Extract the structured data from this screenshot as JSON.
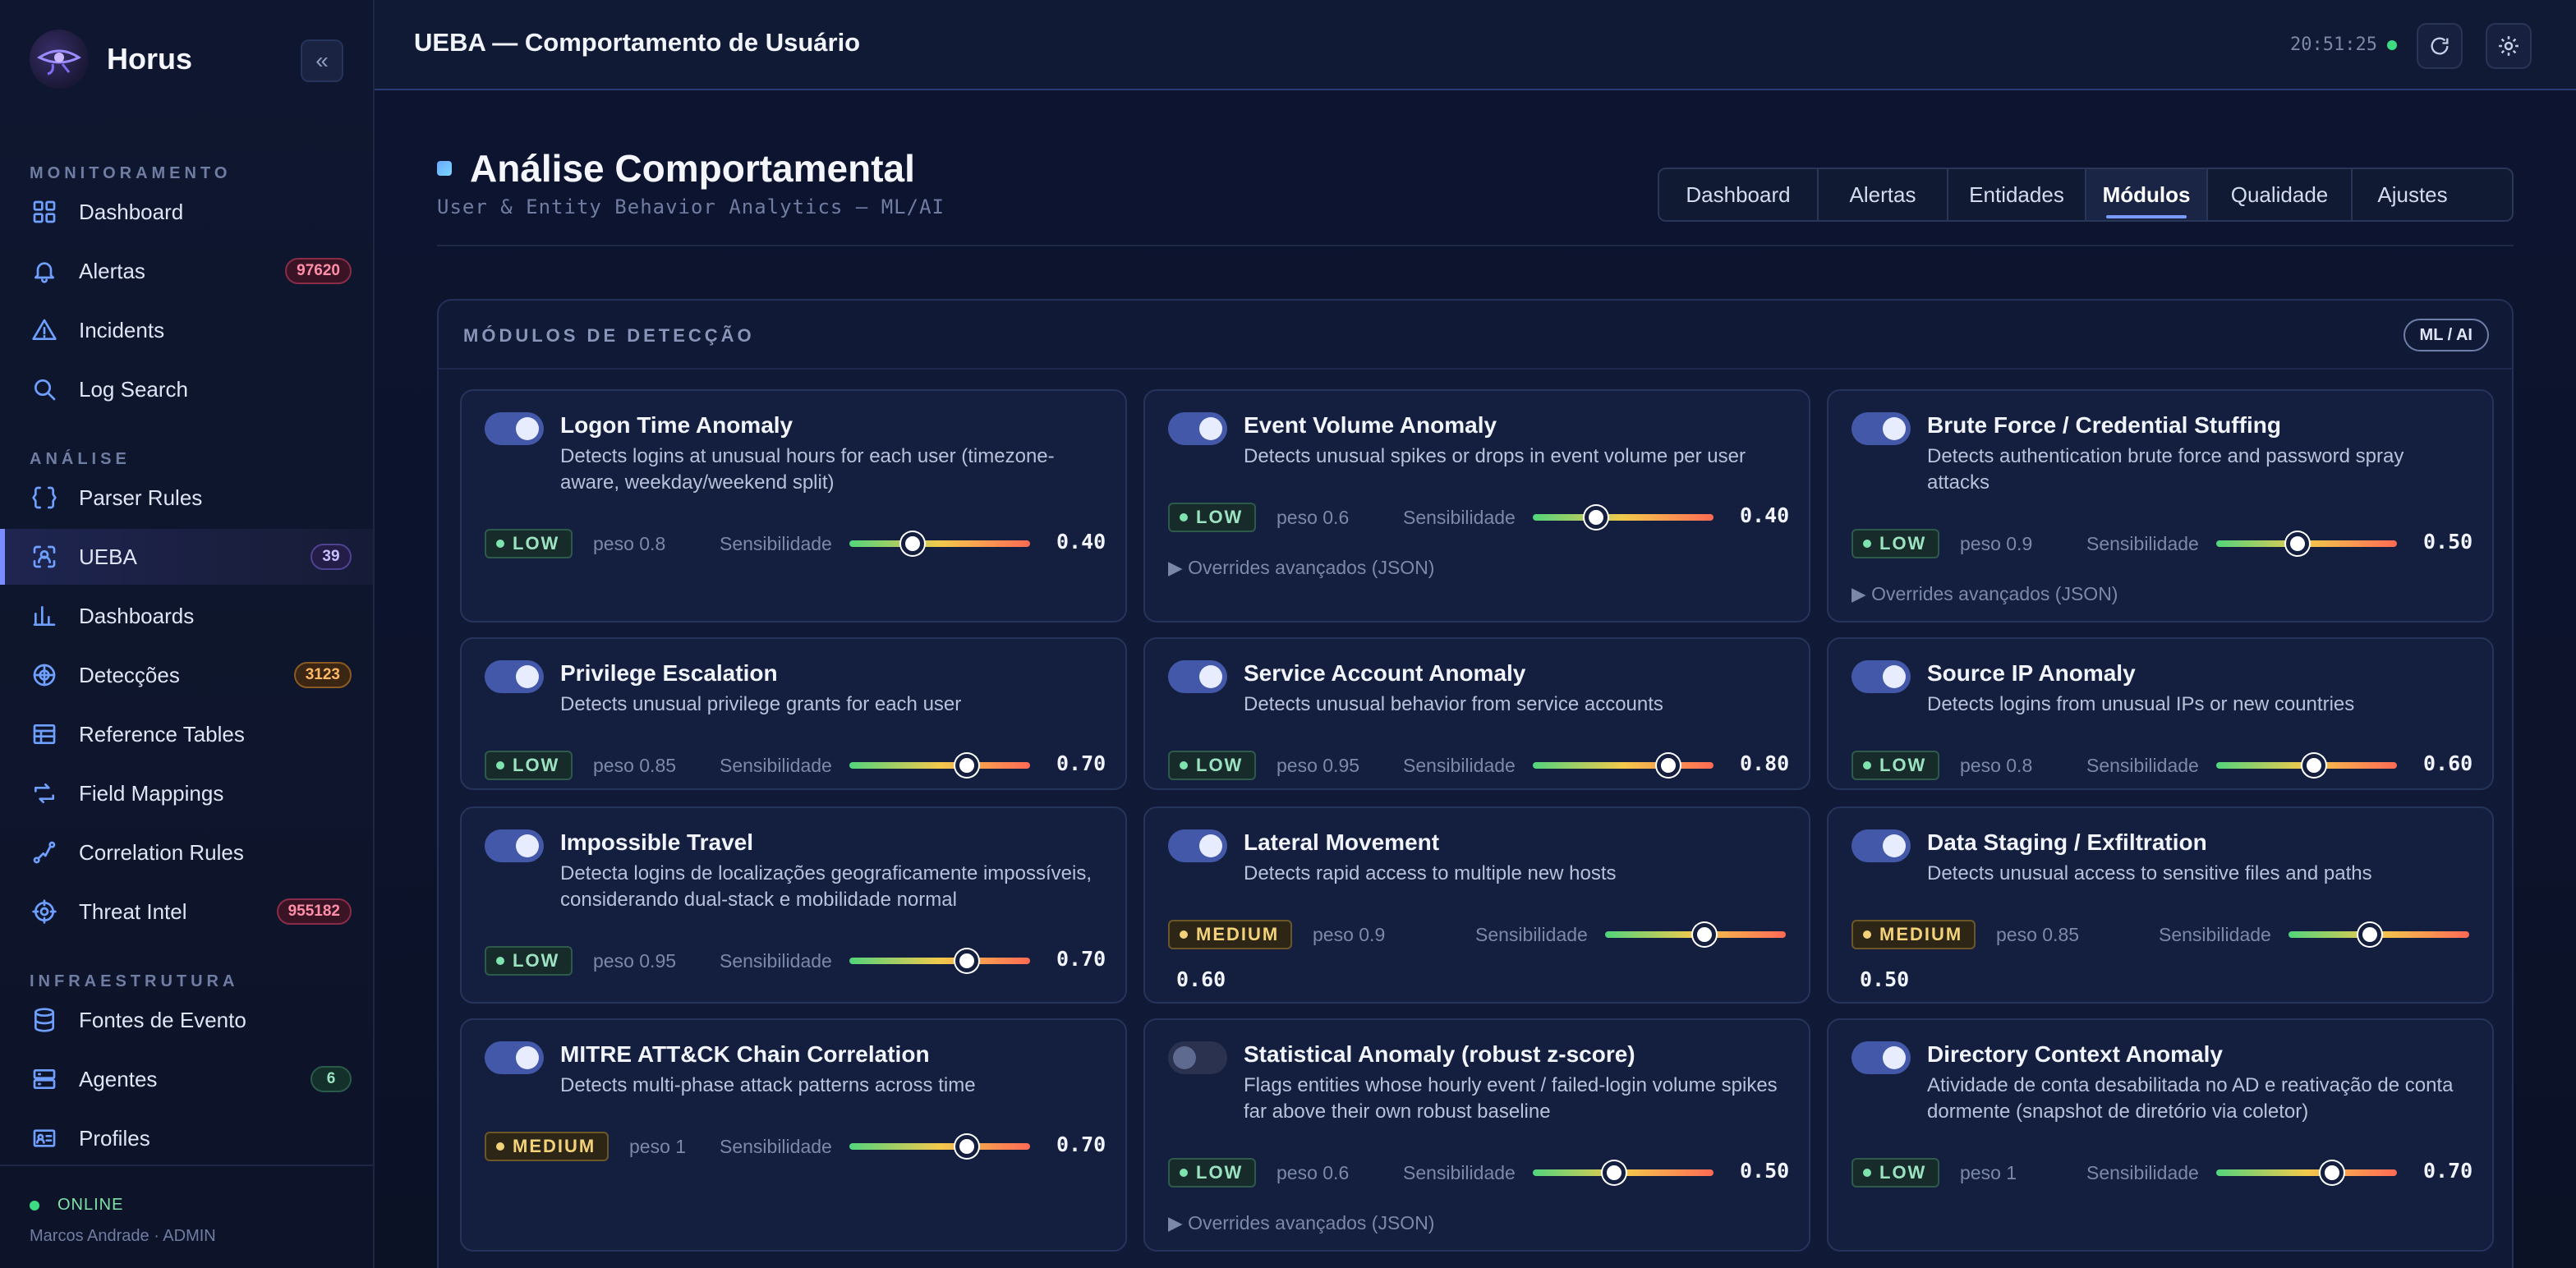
{
  "brand": {
    "name": "Horus"
  },
  "sidebar": {
    "sections": [
      {
        "title": "MONITORAMENTO",
        "items": [
          {
            "label": "Dashboard",
            "icon": "grid-icon"
          },
          {
            "label": "Alertas",
            "icon": "bell-icon",
            "badge": "97620",
            "badge_color": "red"
          },
          {
            "label": "Incidents",
            "icon": "warning-icon"
          },
          {
            "label": "Log Search",
            "icon": "search-icon"
          }
        ]
      },
      {
        "title": "ANÁLISE",
        "items": [
          {
            "label": "Parser Rules",
            "icon": "braces-icon"
          },
          {
            "label": "UEBA",
            "icon": "user-scan-icon",
            "badge": "39",
            "badge_color": "purple",
            "active": true
          },
          {
            "label": "Dashboards",
            "icon": "bar-chart-icon"
          },
          {
            "label": "Detecções",
            "icon": "radar-icon",
            "badge": "3123",
            "badge_color": "orange"
          },
          {
            "label": "Reference Tables",
            "icon": "table-icon"
          },
          {
            "label": "Field Mappings",
            "icon": "mapping-icon"
          },
          {
            "label": "Correlation Rules",
            "icon": "correlation-icon"
          },
          {
            "label": "Threat Intel",
            "icon": "threat-intel-icon",
            "badge": "955182",
            "badge_color": "red"
          }
        ]
      },
      {
        "title": "INFRAESTRUTURA",
        "items": [
          {
            "label": "Fontes de Evento",
            "icon": "database-icon"
          },
          {
            "label": "Agentes",
            "icon": "server-icon",
            "badge": "6",
            "badge_color": "green"
          },
          {
            "label": "Profiles",
            "icon": "id-card-icon"
          }
        ]
      }
    ],
    "status": "ONLINE",
    "user": "Marcos Andrade · ADMIN"
  },
  "topbar": {
    "title": "UEBA — Comportamento de Usuário",
    "clock": "20:51:25"
  },
  "page": {
    "title": "Análise Comportamental",
    "subtitle": "User & Entity Behavior Analytics — ML/AI",
    "tabs": [
      {
        "label": "Dashboard"
      },
      {
        "label": "Alertas"
      },
      {
        "label": "Entidades"
      },
      {
        "label": "Módulos",
        "active": true
      },
      {
        "label": "Qualidade"
      },
      {
        "label": "Ajustes"
      }
    ]
  },
  "panel": {
    "title": "MÓDULOS DE DETECÇÃO",
    "pill": "ML / AI",
    "sens_label": "Sensibilidade",
    "overrides_label": "▶ Overrides avançados (JSON)",
    "modules": [
      {
        "title": "Logon Time Anomaly",
        "desc": "Detects logins at unusual hours for each user (timezone-aware, weekday/weekend split)",
        "level": "LOW",
        "peso": "peso 0.8",
        "sens": 0.4,
        "sens_text": "0.40",
        "enabled": true,
        "overrides": false
      },
      {
        "title": "Event Volume Anomaly",
        "desc": "Detects unusual spikes or drops in event volume per user",
        "level": "LOW",
        "peso": "peso 0.6",
        "sens": 0.4,
        "sens_text": "0.40",
        "enabled": true,
        "overrides": true
      },
      {
        "title": "Brute Force / Credential Stuffing",
        "desc": "Detects authentication brute force and password spray attacks",
        "level": "LOW",
        "peso": "peso 0.9",
        "sens": 0.5,
        "sens_text": "0.50",
        "enabled": true,
        "overrides": true
      },
      {
        "title": "Privilege Escalation",
        "desc": "Detects unusual privilege grants for each user",
        "level": "LOW",
        "peso": "peso 0.85",
        "sens": 0.7,
        "sens_text": "0.70",
        "enabled": true,
        "overrides": false
      },
      {
        "title": "Service Account Anomaly",
        "desc": "Detects unusual behavior from service accounts",
        "level": "LOW",
        "peso": "peso 0.95",
        "sens": 0.8,
        "sens_text": "0.80",
        "enabled": true,
        "overrides": false
      },
      {
        "title": "Source IP Anomaly",
        "desc": "Detects logins from unusual IPs or new countries",
        "level": "LOW",
        "peso": "peso 0.8",
        "sens": 0.6,
        "sens_text": "0.60",
        "enabled": true,
        "overrides": false
      },
      {
        "title": "Impossible Travel",
        "desc": "Detecta logins de localizações geograficamente impossíveis, considerando dual-stack e mobilidade normal",
        "level": "LOW",
        "peso": "peso 0.95",
        "sens": 0.7,
        "sens_text": "0.70",
        "enabled": true,
        "overrides": false
      },
      {
        "title": "Lateral Movement",
        "desc": "Detects rapid access to multiple new hosts",
        "level": "MEDIUM",
        "peso": "peso 0.9",
        "sens": 0.6,
        "sens_text": "0.60",
        "enabled": true,
        "overrides": false
      },
      {
        "title": "Data Staging / Exfiltration",
        "desc": "Detects unusual access to sensitive files and paths",
        "level": "MEDIUM",
        "peso": "peso 0.85",
        "sens": 0.5,
        "sens_text": "0.50",
        "enabled": true,
        "overrides": false
      },
      {
        "title": "MITRE ATT&CK Chain Correlation",
        "desc": "Detects multi-phase attack patterns across time",
        "level": "MEDIUM",
        "peso": "peso 1",
        "sens": 0.7,
        "sens_text": "0.70",
        "enabled": true,
        "overrides": false
      },
      {
        "title": "Statistical Anomaly (robust z-score)",
        "desc": "Flags entities whose hourly event / failed-login volume spikes far above their own robust baseline",
        "level": "LOW",
        "peso": "peso 0.6",
        "sens": 0.5,
        "sens_text": "0.50",
        "enabled": false,
        "overrides": true
      },
      {
        "title": "Directory Context Anomaly",
        "desc": "Atividade de conta desabilitada no AD e reativação de conta dormente (snapshot de diretório via coletor)",
        "level": "LOW",
        "peso": "peso 1",
        "sens": 0.7,
        "sens_text": "0.70",
        "enabled": true,
        "overrides": false
      }
    ]
  }
}
